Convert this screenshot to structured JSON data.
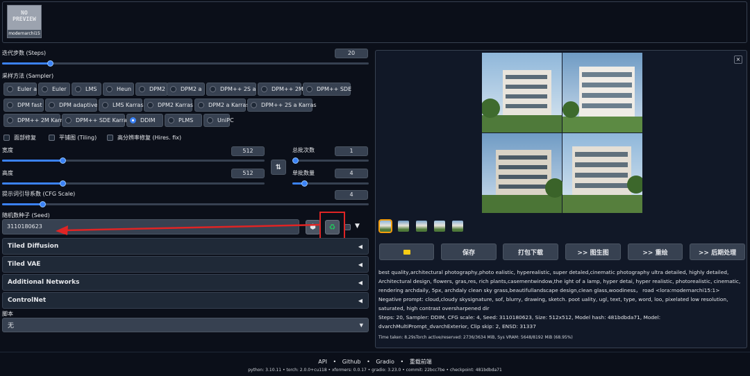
{
  "checkpoint_card": {
    "preview_text": "NO\nPREVIEW",
    "name": "modernarchi15"
  },
  "steps": {
    "label": "迭代步数 (Steps)",
    "value": "20",
    "fraction": 0.13
  },
  "sampler": {
    "label": "采样方法 (Sampler)",
    "selected": "DDIM",
    "options": [
      "Euler a",
      "Euler",
      "LMS",
      "Heun",
      "DPM2",
      "DPM2 a",
      "DPM++ 2S a",
      "DPM++ 2M",
      "DPM++ SDE",
      "DPM fast",
      "DPM adaptive",
      "LMS Karras",
      "DPM2 Karras",
      "DPM2 a Karras",
      "DPM++ 2S a Karras",
      "DPM++ 2M Karras",
      "DPM++ SDE Karras",
      "DDIM",
      "PLMS",
      "UniPC"
    ]
  },
  "checkboxes": {
    "restore_faces": "面部修复",
    "tiling": "平铺图 (Tiling)",
    "hires_fix": "高分辨率修复 (Hires. fix)"
  },
  "width": {
    "label": "宽度",
    "value": "512",
    "fraction": 0.23
  },
  "height": {
    "label": "高度",
    "value": "512",
    "fraction": 0.23
  },
  "batch_count": {
    "label": "总批次数",
    "value": "1",
    "fraction": 0.0
  },
  "batch_size": {
    "label": "单批数量",
    "value": "4",
    "fraction": 0.15
  },
  "swap_icon": "swap-vertical-icon",
  "cfg": {
    "label": "提示词引导系数 (CFG Scale)",
    "value": "4",
    "fraction": 0.1
  },
  "seed": {
    "label": "随机数种子 (Seed)",
    "value": "3110180623",
    "dice_icon": "dice-icon",
    "recycle_icon": "recycle-icon",
    "extra_icon": "chevron-down-icon"
  },
  "accordions": [
    "Tiled Diffusion",
    "Tiled VAE",
    "Additional Networks",
    "ControlNet"
  ],
  "script": {
    "label": "脚本",
    "value": "无"
  },
  "gallery": {
    "close_label": "×",
    "thumbnail_count": 5
  },
  "actions": {
    "folder_icon": "folder-icon",
    "save": "保存",
    "zip": "打包下载",
    "img2img": ">> 图生图",
    "inpaint": ">> 重绘",
    "extras": ">> 后期处理"
  },
  "info": {
    "prompt": "best quality,architectural photography,photo ealistic, hyperealistic, super detaled,cinematic photography ultra detailed, highly detailed, Architectural design, flowers, gras,res, rich plants,casementwindow,the ight of a lamp, hyper detai, hyper realistic, photorealistic, cinematic, rendering archdaily, 5px, archdaly clean sky grass,beautifullandscape design,clean glass,woodiness， road <lora:modernarchi15:1>",
    "negative": "Negative prompt: cloud,cloudy skysignature, sof, blurry, drawing, sketch. poot uality, ugl, text, type, word, loo, pixelated low resolution, saturated, high contrast oversharpened dir",
    "params": "Steps: 20, Sampler: DDIM, CFG scale: 4, Seed: 3110180623, Size: 512x512, Model hash: 481bdbda71, Model: dvarchMultiPrompt_dvarchExterior, Clip skip: 2, ENSD: 31337",
    "time": "Time taken: 8.29sTorch active/reserved: 2736/3634 MiB, Sys VRAM: 5648/8192 MiB (68.95%)"
  },
  "footer": {
    "links": [
      "API",
      "Github",
      "Gradio",
      "重载前端"
    ],
    "separator": "•",
    "versions": "python: 3.10.11  •  torch: 2.0.0+cu118  •  xformers: 0.0.17  •  gradio: 3.23.0  •  commit: 22bcc7be  •  checkpoint: 481bdbda71"
  },
  "colors": {
    "background": "#0b0f19",
    "panel": "#1f2937",
    "accent": "#3b82f6",
    "annotation_red": "#e02424"
  }
}
